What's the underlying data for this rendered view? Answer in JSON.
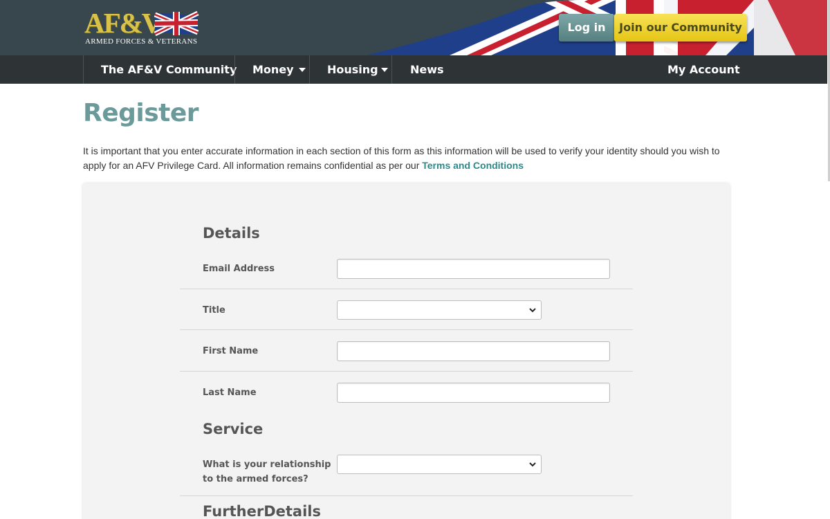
{
  "header": {
    "logo_text": "AF&V",
    "logo_subtitle": "ARMED FORCES & VETERANS",
    "login_label": "Log in",
    "join_label": "Join our Community"
  },
  "nav": {
    "items": [
      {
        "label": "The AF&V Community"
      },
      {
        "label": "Money"
      },
      {
        "label": "Housing"
      },
      {
        "label": "News"
      }
    ],
    "account_label": "My Account"
  },
  "page": {
    "title": "Register",
    "intro_text": "It is important that you enter accurate information in each section of this form as this information will be used to verify your identity should you wish to apply for an AFV Privilege Card. All information remains confidential as per our",
    "terms_link": "Terms and Conditions"
  },
  "form": {
    "details_heading": "Details",
    "email_label": "Email Address",
    "email_value": "",
    "title_label": "Title",
    "title_value": "",
    "first_name_label": "First Name",
    "first_name_value": "",
    "last_name_label": "Last Name",
    "last_name_value": "",
    "service_heading": "Service",
    "relationship_label_line1": "What is your relationship",
    "relationship_label_line2": "to the armed forces?",
    "relationship_value": "",
    "further_heading": "FurtherDetails"
  },
  "colors": {
    "header_bg": "#37474d",
    "nav_bg": "#2e3436",
    "title_teal": "#6a9a9a",
    "link_teal": "#2a8a8a",
    "login_btn": "#6f999a",
    "join_btn": "#f0d232"
  }
}
